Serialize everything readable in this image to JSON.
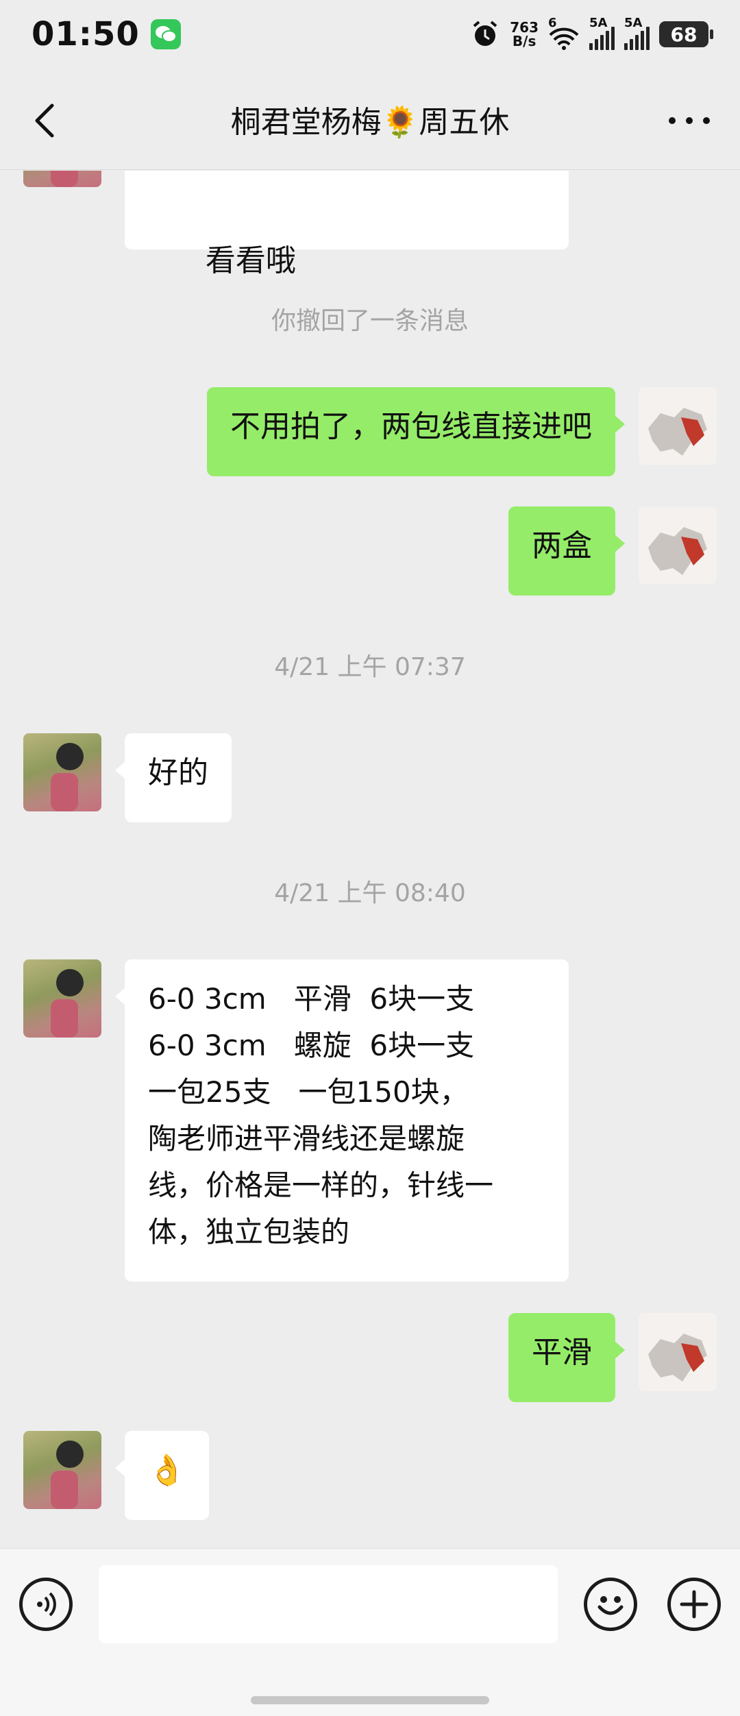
{
  "status_bar": {
    "time": "01:50",
    "net_speed_value": "763",
    "net_speed_unit": "B/s",
    "wifi_label": "6",
    "signal1_label": "5A",
    "signal2_label": "5A",
    "battery": "68"
  },
  "header": {
    "title": "桐君堂杨梅🌻周五休"
  },
  "messages": {
    "m0_text": "看看哦",
    "m1_system": "你撤回了一条消息",
    "m2_text": "不用拍了，两包线直接进吧",
    "m3_text": "两盒",
    "m4_time": "4/21 上午 07:37",
    "m5_text": "好的",
    "m6_time": "4/21 上午 08:40",
    "m7_text": "6-0 3cm   平滑  6块一支\n6-0 3cm   螺旋  6块一支\n一包25支   一包150块，\n陶老师进平滑线还是螺旋\n线，价格是一样的，针线一\n体，独立包装的",
    "m8_text": "平滑",
    "m9_text": "👌"
  },
  "colors": {
    "background": "#ededed",
    "sent_bubble": "#95ec69",
    "received_bubble": "#ffffff",
    "system_text": "#a4a4a4"
  },
  "icons": {
    "back": "chevron-left-icon",
    "more": "more-dots-icon",
    "voice": "voice-icon",
    "emoji": "emoji-icon",
    "plus": "plus-icon"
  }
}
